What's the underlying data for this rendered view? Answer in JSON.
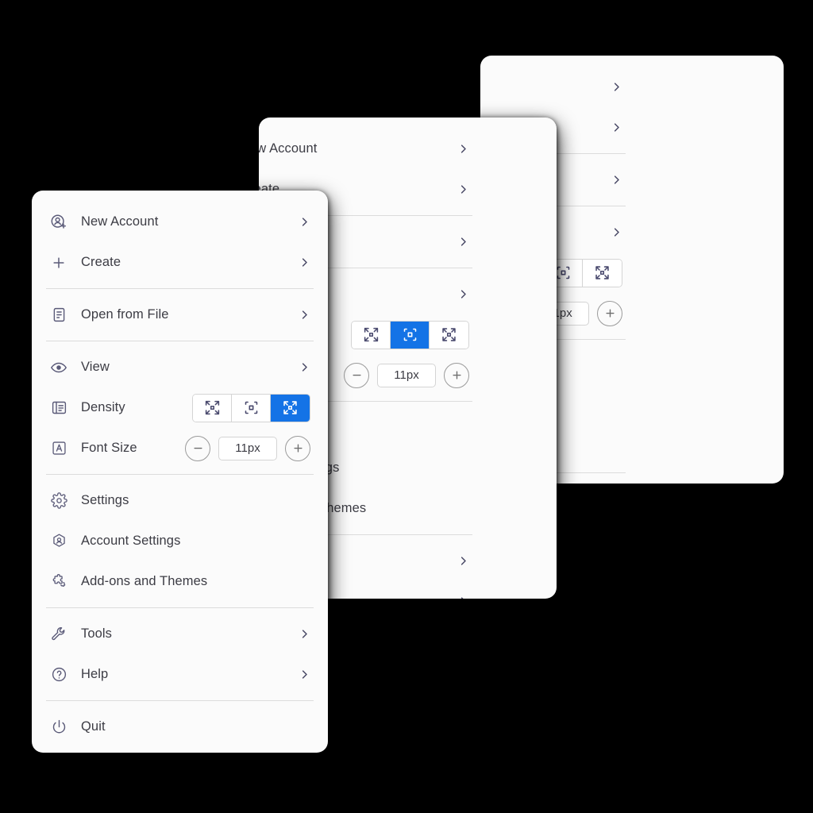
{
  "background_color": "#000000",
  "panel_color": "#fbfbfb",
  "accent_color": "#1473e6",
  "text_color": "#3c3c44",
  "icon_color": "#5a5a78",
  "divider_color": "#dcdcdc",
  "menu": {
    "groups": [
      {
        "items": [
          {
            "label": "New Account",
            "icon": "new-account-icon",
            "chevron": true
          },
          {
            "label": "Create",
            "icon": "plus-icon",
            "chevron": true
          }
        ]
      },
      {
        "items": [
          {
            "label": "Open from File",
            "icon": "document-icon",
            "chevron": true
          }
        ]
      },
      {
        "items": [
          {
            "label": "View",
            "icon": "eye-icon",
            "chevron": true
          },
          {
            "label": "Density",
            "icon": "density-list-icon",
            "control": "density"
          },
          {
            "label": "Font Size",
            "icon": "font-size-icon",
            "control": "fontsize"
          }
        ]
      },
      {
        "items": [
          {
            "label": "Settings",
            "icon": "gear-icon",
            "chevron": false
          },
          {
            "label": "Account Settings",
            "icon": "account-badge-icon",
            "chevron": false
          },
          {
            "label": "Add-ons and Themes",
            "icon": "puzzle-icon",
            "chevron": false
          }
        ]
      },
      {
        "items": [
          {
            "label": "Tools",
            "icon": "wrench-icon",
            "chevron": true
          },
          {
            "label": "Help",
            "icon": "question-circle-icon",
            "chevron": true
          }
        ]
      },
      {
        "items": [
          {
            "label": "Quit",
            "icon": "power-icon",
            "chevron": false
          }
        ]
      }
    ]
  },
  "density_control": {
    "name": "density-segmented-control",
    "options": [
      {
        "value": "compact",
        "icon": "arrows-in-icon"
      },
      {
        "value": "cozy",
        "icon": "brackets-square-icon"
      },
      {
        "value": "comfortable",
        "icon": "arrows-out-icon"
      }
    ]
  },
  "font_size_control": {
    "name": "font-size-stepper",
    "decrement_label": "minus-icon",
    "increment_label": "plus-icon",
    "value": "11px"
  },
  "panels": [
    {
      "id": "back",
      "density_selected": "compact",
      "font_size_value": "11px"
    },
    {
      "id": "middle",
      "density_selected": "cozy",
      "font_size_value": "11px"
    },
    {
      "id": "front",
      "density_selected": "comfortable",
      "font_size_value": "11px"
    }
  ]
}
